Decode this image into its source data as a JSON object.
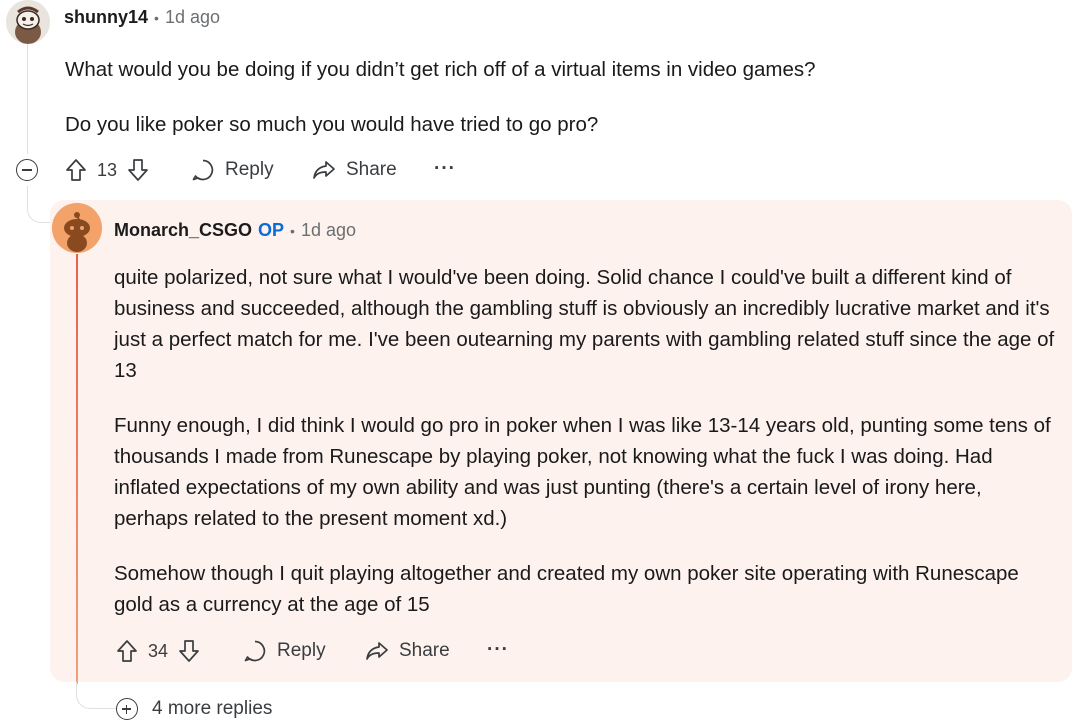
{
  "comment1": {
    "username": "shunny14",
    "separator": "•",
    "time": "1d ago",
    "paragraphs": [
      "What would you be doing if you didn’t get rich off of a virtual items in video games?",
      "Do you like poker so much you would have tried to go pro?"
    ],
    "votes": "13",
    "reply_label": "Reply",
    "share_label": "Share",
    "more_label": "···"
  },
  "comment2": {
    "username": "Monarch_CSGO",
    "op_badge": "OP",
    "separator": "•",
    "time": "1d ago",
    "paragraphs": [
      "quite polarized, not sure what I would've been doing. Solid chance I could've built a different kind of business and succeeded, although the gambling stuff is obviously an incredibly lucrative market and it's just a perfect match for me. I've been outearning my parents with gambling related stuff since the age of 13",
      "Funny enough, I did think I would go pro in poker when I was like 13-14 years old, punting some tens of thousands I made from Runescape by playing poker, not knowing what the fuck I was doing. Had inflated expectations of my own ability and was just punting (there's a certain level of irony here, perhaps related to the present moment xd.)",
      "Somehow though I quit playing altogether and created my own poker site operating with Runescape gold as a currency at the age of 15"
    ],
    "votes": "34",
    "reply_label": "Reply",
    "share_label": "Share",
    "more_label": "···"
  },
  "more_replies_label": "4 more replies",
  "colors": {
    "highlight_bg": "#fdf2ee",
    "highlight_bar": "#e8624a",
    "op_badge": "#0a6ad6",
    "meta": "#6b6f72"
  },
  "icons": {
    "avatar1": "snoo-avatar-icon",
    "avatar2": "snoo-avatar-icon",
    "upvote": "arrow-up-icon",
    "downvote": "arrow-down-icon",
    "reply": "speech-bubble-icon",
    "share": "share-arrow-icon",
    "collapse": "minus-circle-icon",
    "expand": "plus-circle-icon"
  }
}
